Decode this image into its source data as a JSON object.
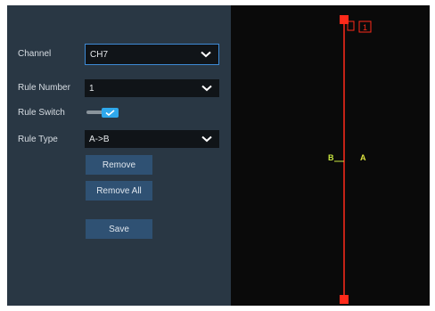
{
  "form": {
    "channel": {
      "label": "Channel",
      "value": "CH7"
    },
    "rule_number": {
      "label": "Rule Number",
      "value": "1"
    },
    "rule_switch": {
      "label": "Rule Switch",
      "enabled": true
    },
    "rule_type": {
      "label": "Rule Type",
      "value": "A->B"
    }
  },
  "buttons": {
    "remove": "Remove",
    "remove_all": "Remove All",
    "save": "Save"
  },
  "preview": {
    "line_id": "1",
    "side_b": "B",
    "side_a": "A"
  },
  "colors": {
    "accent": "#2fa8ec",
    "button": "#2f5173",
    "line": "#ff2a1a",
    "side_b": "#c8e640",
    "side_a": "#e0e640"
  }
}
